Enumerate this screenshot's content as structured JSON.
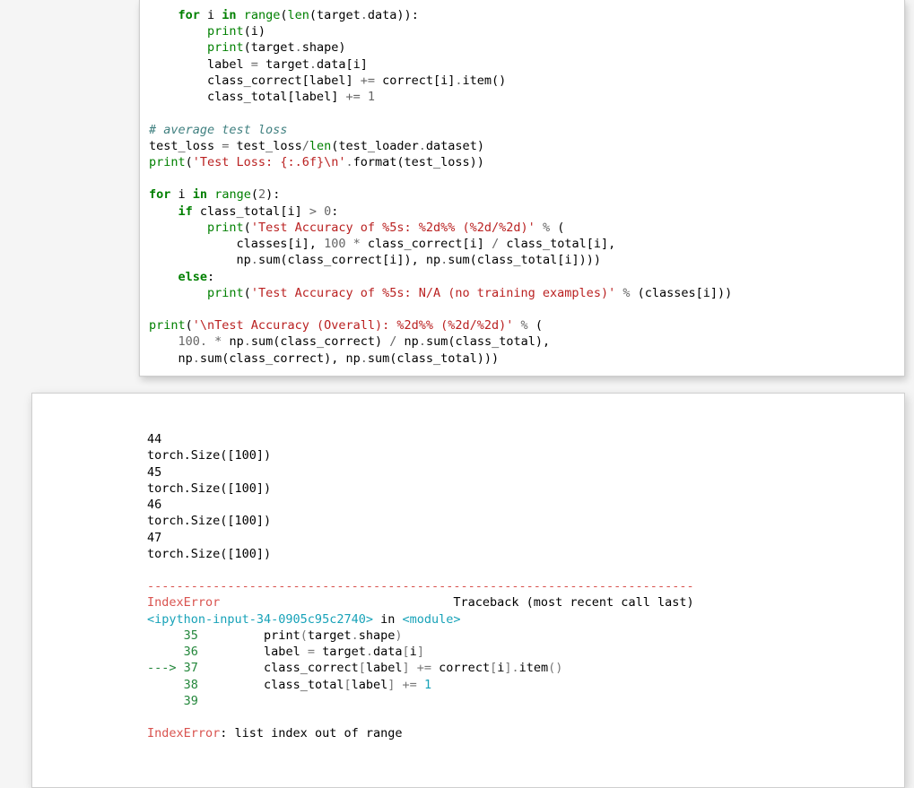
{
  "input_cell": {
    "lines": [
      [
        {
          "c": "",
          "t": "    "
        },
        {
          "c": "kw",
          "t": "for"
        },
        {
          "c": "",
          "t": " i "
        },
        {
          "c": "kw",
          "t": "in"
        },
        {
          "c": "",
          "t": " "
        },
        {
          "c": "bi",
          "t": "range"
        },
        {
          "c": "",
          "t": "("
        },
        {
          "c": "bi",
          "t": "len"
        },
        {
          "c": "",
          "t": "(target"
        },
        {
          "c": "op",
          "t": "."
        },
        {
          "c": "",
          "t": "data)):"
        }
      ],
      [
        {
          "c": "",
          "t": "        "
        },
        {
          "c": "bi",
          "t": "print"
        },
        {
          "c": "",
          "t": "(i)"
        }
      ],
      [
        {
          "c": "",
          "t": "        "
        },
        {
          "c": "bi",
          "t": "print"
        },
        {
          "c": "",
          "t": "(target"
        },
        {
          "c": "op",
          "t": "."
        },
        {
          "c": "",
          "t": "shape)"
        }
      ],
      [
        {
          "c": "",
          "t": "        label "
        },
        {
          "c": "op",
          "t": "="
        },
        {
          "c": "",
          "t": " target"
        },
        {
          "c": "op",
          "t": "."
        },
        {
          "c": "",
          "t": "data[i]"
        }
      ],
      [
        {
          "c": "",
          "t": "        class_correct[label] "
        },
        {
          "c": "op",
          "t": "+="
        },
        {
          "c": "",
          "t": " correct[i]"
        },
        {
          "c": "op",
          "t": "."
        },
        {
          "c": "",
          "t": "item()"
        }
      ],
      [
        {
          "c": "",
          "t": "        class_total[label] "
        },
        {
          "c": "op",
          "t": "+="
        },
        {
          "c": "",
          "t": " "
        },
        {
          "c": "num",
          "t": "1"
        }
      ],
      [
        {
          "c": "",
          "t": ""
        }
      ],
      [
        {
          "c": "cm",
          "t": "# average test loss"
        }
      ],
      [
        {
          "c": "",
          "t": "test_loss "
        },
        {
          "c": "op",
          "t": "="
        },
        {
          "c": "",
          "t": " test_loss"
        },
        {
          "c": "op",
          "t": "/"
        },
        {
          "c": "bi",
          "t": "len"
        },
        {
          "c": "",
          "t": "(test_loader"
        },
        {
          "c": "op",
          "t": "."
        },
        {
          "c": "",
          "t": "dataset)"
        }
      ],
      [
        {
          "c": "bi",
          "t": "print"
        },
        {
          "c": "",
          "t": "("
        },
        {
          "c": "str",
          "t": "'Test Loss: {:.6f}\\n'"
        },
        {
          "c": "op",
          "t": "."
        },
        {
          "c": "",
          "t": "format(test_loss))"
        }
      ],
      [
        {
          "c": "",
          "t": ""
        }
      ],
      [
        {
          "c": "kw",
          "t": "for"
        },
        {
          "c": "",
          "t": " i "
        },
        {
          "c": "kw",
          "t": "in"
        },
        {
          "c": "",
          "t": " "
        },
        {
          "c": "bi",
          "t": "range"
        },
        {
          "c": "",
          "t": "("
        },
        {
          "c": "num",
          "t": "2"
        },
        {
          "c": "",
          "t": "):"
        }
      ],
      [
        {
          "c": "",
          "t": "    "
        },
        {
          "c": "kw",
          "t": "if"
        },
        {
          "c": "",
          "t": " class_total[i] "
        },
        {
          "c": "op",
          "t": ">"
        },
        {
          "c": "",
          "t": " "
        },
        {
          "c": "num",
          "t": "0"
        },
        {
          "c": "",
          "t": ":"
        }
      ],
      [
        {
          "c": "",
          "t": "        "
        },
        {
          "c": "bi",
          "t": "print"
        },
        {
          "c": "",
          "t": "("
        },
        {
          "c": "str",
          "t": "'Test Accuracy of %5s: %2d%% (%2d/%2d)'"
        },
        {
          "c": "",
          "t": " "
        },
        {
          "c": "op",
          "t": "%"
        },
        {
          "c": "",
          "t": " ("
        }
      ],
      [
        {
          "c": "",
          "t": "            classes[i], "
        },
        {
          "c": "num",
          "t": "100"
        },
        {
          "c": "",
          "t": " "
        },
        {
          "c": "op",
          "t": "*"
        },
        {
          "c": "",
          "t": " class_correct[i] "
        },
        {
          "c": "op",
          "t": "/"
        },
        {
          "c": "",
          "t": " class_total[i],"
        }
      ],
      [
        {
          "c": "",
          "t": "            np"
        },
        {
          "c": "op",
          "t": "."
        },
        {
          "c": "",
          "t": "sum(class_correct[i]), np"
        },
        {
          "c": "op",
          "t": "."
        },
        {
          "c": "",
          "t": "sum(class_total[i])))"
        }
      ],
      [
        {
          "c": "",
          "t": "    "
        },
        {
          "c": "kw",
          "t": "else"
        },
        {
          "c": "",
          "t": ":"
        }
      ],
      [
        {
          "c": "",
          "t": "        "
        },
        {
          "c": "bi",
          "t": "print"
        },
        {
          "c": "",
          "t": "("
        },
        {
          "c": "str",
          "t": "'Test Accuracy of %5s: N/A (no training examples)'"
        },
        {
          "c": "",
          "t": " "
        },
        {
          "c": "op",
          "t": "%"
        },
        {
          "c": "",
          "t": " (classes[i]))"
        }
      ],
      [
        {
          "c": "",
          "t": ""
        }
      ],
      [
        {
          "c": "bi",
          "t": "print"
        },
        {
          "c": "",
          "t": "("
        },
        {
          "c": "str",
          "t": "'\\nTest Accuracy (Overall): %2d%% (%2d/%2d)'"
        },
        {
          "c": "",
          "t": " "
        },
        {
          "c": "op",
          "t": "%"
        },
        {
          "c": "",
          "t": " ("
        }
      ],
      [
        {
          "c": "",
          "t": "    "
        },
        {
          "c": "num",
          "t": "100."
        },
        {
          "c": "",
          "t": " "
        },
        {
          "c": "op",
          "t": "*"
        },
        {
          "c": "",
          "t": " np"
        },
        {
          "c": "op",
          "t": "."
        },
        {
          "c": "",
          "t": "sum(class_correct) "
        },
        {
          "c": "op",
          "t": "/"
        },
        {
          "c": "",
          "t": " np"
        },
        {
          "c": "op",
          "t": "."
        },
        {
          "c": "",
          "t": "sum(class_total),"
        }
      ],
      [
        {
          "c": "",
          "t": "    np"
        },
        {
          "c": "op",
          "t": "."
        },
        {
          "c": "",
          "t": "sum(class_correct), np"
        },
        {
          "c": "op",
          "t": "."
        },
        {
          "c": "",
          "t": "sum(class_total)))"
        }
      ]
    ]
  },
  "output_cell": {
    "stdout": [
      "44",
      "torch.Size([100])",
      "45",
      "torch.Size([100])",
      "46",
      "torch.Size([100])",
      "47",
      "torch.Size([100])",
      ""
    ],
    "dashes": "---------------------------------------------------------------------------",
    "error_name": "IndexError",
    "traceback_label": "Traceback (most recent call last)",
    "frame_file": "<ipython-input-34-0905c95c2740>",
    "in_kw": " in ",
    "module_name": "<module>",
    "tb_lines": [
      {
        "arrow": "     ",
        "num": "35",
        "body": [
          {
            "c": "",
            "t": "         print"
          },
          {
            "c": "err-grey",
            "t": "("
          },
          {
            "c": "",
            "t": "target"
          },
          {
            "c": "err-grey",
            "t": "."
          },
          {
            "c": "",
            "t": "shape"
          },
          {
            "c": "err-grey",
            "t": ")"
          }
        ]
      },
      {
        "arrow": "     ",
        "num": "36",
        "body": [
          {
            "c": "",
            "t": "         label "
          },
          {
            "c": "err-grey",
            "t": "="
          },
          {
            "c": "",
            "t": " target"
          },
          {
            "c": "err-grey",
            "t": "."
          },
          {
            "c": "",
            "t": "data"
          },
          {
            "c": "err-grey",
            "t": "["
          },
          {
            "c": "",
            "t": "i"
          },
          {
            "c": "err-grey",
            "t": "]"
          }
        ]
      },
      {
        "arrow": "---> ",
        "num": "37",
        "body": [
          {
            "c": "",
            "t": "         class_correct"
          },
          {
            "c": "err-grey",
            "t": "["
          },
          {
            "c": "",
            "t": "label"
          },
          {
            "c": "err-grey",
            "t": "]"
          },
          {
            "c": "",
            "t": " "
          },
          {
            "c": "err-grey",
            "t": "+="
          },
          {
            "c": "",
            "t": " correct"
          },
          {
            "c": "err-grey",
            "t": "["
          },
          {
            "c": "",
            "t": "i"
          },
          {
            "c": "err-grey",
            "t": "]."
          },
          {
            "c": "",
            "t": "item"
          },
          {
            "c": "err-grey",
            "t": "()"
          }
        ]
      },
      {
        "arrow": "     ",
        "num": "38",
        "body": [
          {
            "c": "",
            "t": "         class_total"
          },
          {
            "c": "err-grey",
            "t": "["
          },
          {
            "c": "",
            "t": "label"
          },
          {
            "c": "err-grey",
            "t": "]"
          },
          {
            "c": "",
            "t": " "
          },
          {
            "c": "err-grey",
            "t": "+="
          },
          {
            "c": "",
            "t": " "
          },
          {
            "c": "err-cyan",
            "t": "1"
          }
        ]
      },
      {
        "arrow": "     ",
        "num": "39",
        "body": [
          {
            "c": "",
            "t": ""
          }
        ]
      }
    ],
    "final_error_name": "IndexError",
    "final_error_msg": ": list index out of range"
  }
}
